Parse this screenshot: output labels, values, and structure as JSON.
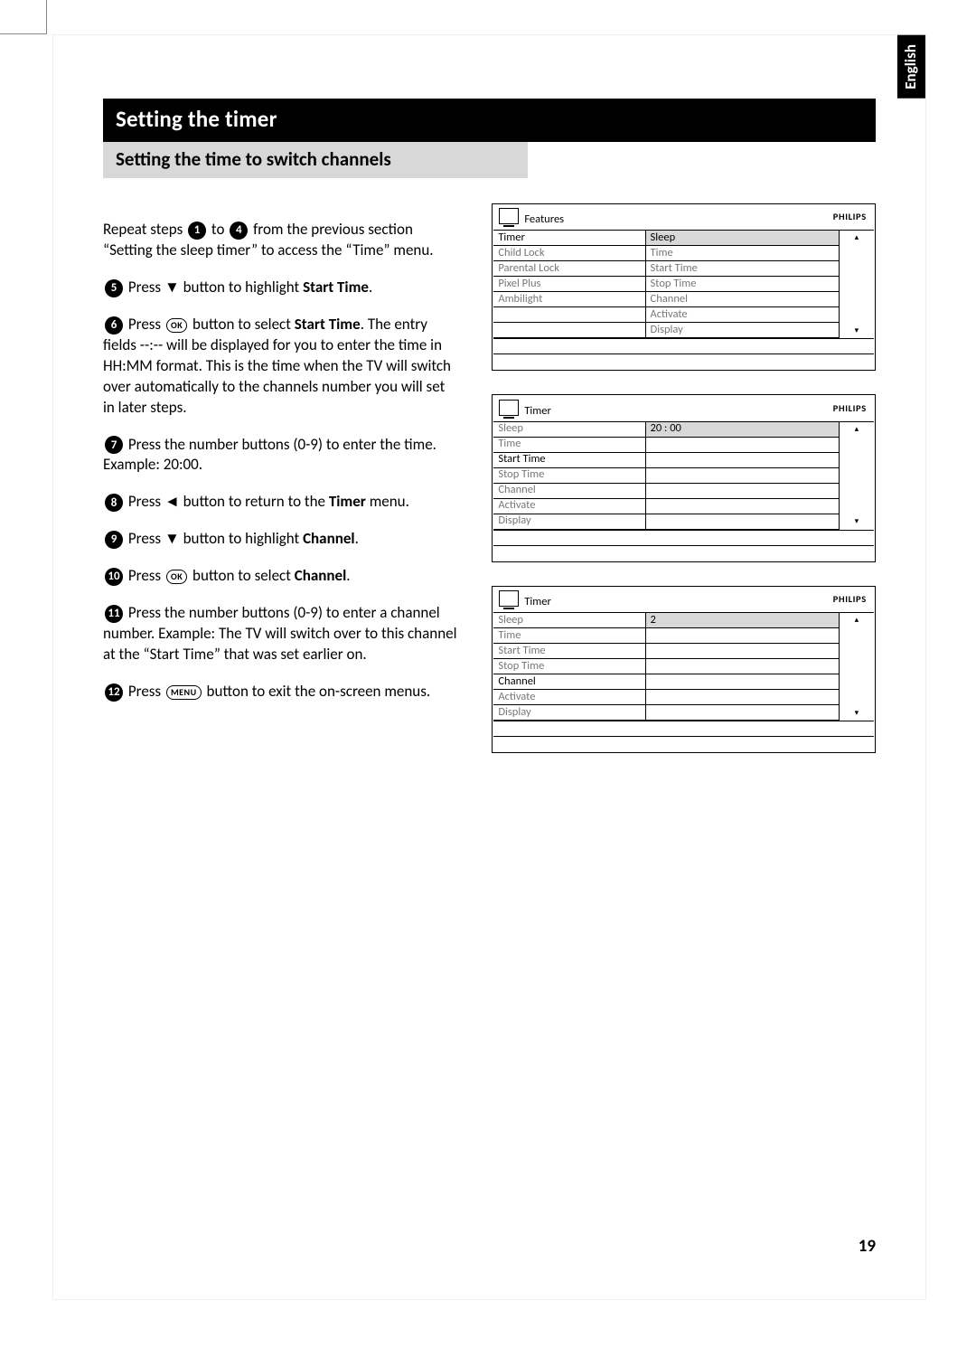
{
  "page_number": "19",
  "language_tab": "English",
  "title": "Setting the timer",
  "subtitle": "Setting the time to switch channels",
  "intro_a": "Repeat steps ",
  "intro_b": " to ",
  "intro_c": " from the previous section “Setting the sleep timer” to access the “Time” menu.",
  "glyphs": {
    "s1": "1",
    "s4": "4",
    "s5": "5",
    "s6": "6",
    "s7": "7",
    "s8": "8",
    "s9": "9",
    "s10": "10",
    "s11": "11",
    "s12": "12",
    "down": "▼",
    "left": "◄",
    "ok": "OK",
    "menu": "MENU"
  },
  "steps": {
    "five_a": "Press ",
    "five_b": " button to highlight ",
    "five_bold": "Start Time",
    "five_c": ".",
    "six_a": "Press ",
    "six_b": " button to select ",
    "six_bold": "Start Time",
    "six_c": ". The entry fields --:-- will be displayed for you to enter the time in HH:MM format.  This is the time when the TV will switch over automatically to the channels number you will set in later steps.",
    "seven": "Press the number buttons (0-9) to enter the time.  Example: 20:00.",
    "eight_a": "Press ",
    "eight_b": " button to return to the ",
    "eight_bold": "Timer",
    "eight_c": " menu.",
    "nine_a": "Press ",
    "nine_b": " button to highlight ",
    "nine_bold": "Channel",
    "nine_c": ".",
    "ten_a": "Press ",
    "ten_b": " button to select ",
    "ten_bold": "Channel",
    "ten_c": ".",
    "eleven": "Press the number buttons (0-9) to enter a channel number.  Example:  The TV will switch over to this channel at the “Start Time” that was set earlier on.",
    "twelve_a": "Press ",
    "twelve_b": " button to exit the on-screen menus."
  },
  "osd_brand": "PHILIPS",
  "osd1": {
    "title": "Features",
    "left": [
      "Timer",
      "Child Lock",
      "Parental Lock",
      "Pixel Plus",
      "Ambilight",
      "",
      ""
    ],
    "left_active": 0,
    "right": [
      "Sleep",
      "Time",
      "Start Time",
      "Stop Time",
      "Channel",
      "Activate",
      "Display"
    ],
    "right_hl": 0
  },
  "osd2": {
    "title": "Timer",
    "left": [
      "Sleep",
      "Time",
      "Start Time",
      "Stop Time",
      "Channel",
      "Activate",
      "Display"
    ],
    "left_active": 2,
    "right": [
      "20 : 00",
      "",
      "",
      "",
      "",
      "",
      ""
    ],
    "right_hl": 0
  },
  "osd3": {
    "title": "Timer",
    "left": [
      "Sleep",
      "Time",
      "Start Time",
      "Stop Time",
      "Channel",
      "Activate",
      "Display"
    ],
    "left_active": 4,
    "right": [
      "2",
      "",
      "",
      "",
      "",
      "",
      ""
    ],
    "right_hl": 0
  },
  "chart_data": null
}
